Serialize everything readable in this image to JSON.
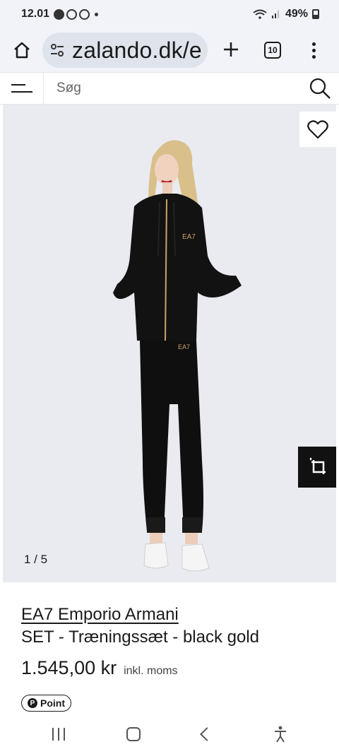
{
  "status_bar": {
    "time": "12.01",
    "battery": "49%"
  },
  "browser": {
    "url": "zalando.dk/e",
    "tab_count": "10"
  },
  "search": {
    "placeholder": "Søg"
  },
  "gallery": {
    "counter": "1 / 5"
  },
  "product": {
    "brand": "EA7 Emporio Armani",
    "name": "SET - Træningssæt - black gold",
    "price": "1.545,00 kr",
    "vat_note": "inkl. moms",
    "point_label": "Point",
    "logo_text": "EA7"
  },
  "colors": {
    "image_bg": "#e9ebf0",
    "tracksuit": "#111111",
    "gold": "#c9a46a"
  },
  "icons": [
    "home-icon",
    "tune-icon",
    "plus-icon",
    "tabs-icon",
    "more-icon",
    "menu-icon",
    "search-icon",
    "heart-icon",
    "crop-icon",
    "point-icon"
  ]
}
